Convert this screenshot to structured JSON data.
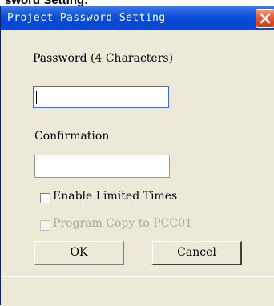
{
  "background_caption": "sword Setting:",
  "window": {
    "title": "Project Password Setting",
    "close_icon": "close-x-icon"
  },
  "form": {
    "password_label": "Password (4 Characters)",
    "password_value": "",
    "confirmation_label": "Confirmation",
    "confirmation_value": "",
    "enable_limited_times_label": "Enable Limited Times",
    "enable_limited_times_checked": false,
    "program_copy_label": "Program Copy to PCC01",
    "program_copy_checked": false,
    "program_copy_enabled": false
  },
  "buttons": {
    "ok_label": "OK",
    "cancel_label": "Cancel"
  },
  "colors": {
    "titlebar": "#0a4fd6",
    "dialog_bg": "#ece9d8",
    "close_button": "#e25a35"
  }
}
